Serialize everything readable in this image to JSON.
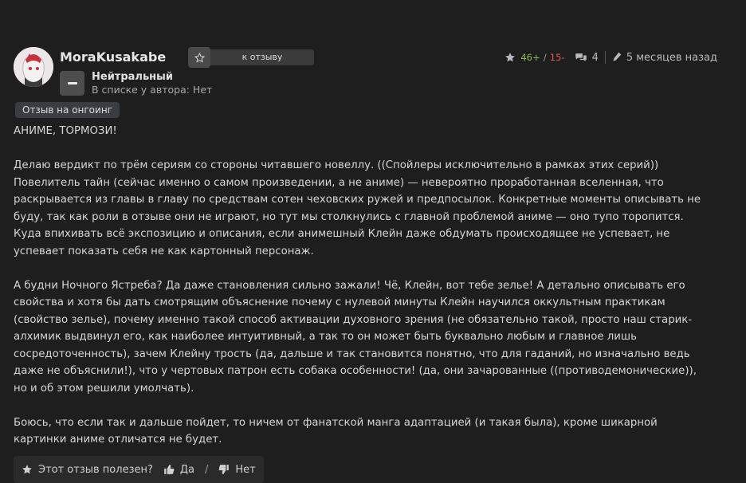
{
  "author": {
    "username": "MoraKusakabe"
  },
  "actions": {
    "to_review_label": "к отзыву"
  },
  "verdict": {
    "label": "Нейтральный",
    "in_list_prefix": "В списке у автора:",
    "in_list_value": "Нет"
  },
  "meta": {
    "votes_plus": "46+",
    "votes_slash": "/",
    "votes_minus": "15-",
    "comments_count": "4",
    "time_ago": "5 месяцев назад"
  },
  "badge": {
    "label": "Отзыв на онгоинг"
  },
  "review": {
    "paragraphs": [
      "АНИМЕ, ТОРМОЗИ!",
      "Делаю вердикт по трём сериям со стороны читавшего новеллу. ((Спойлеры исключительно в рамках этих серий))\nПовелитель тайн (сейчас именно о самом произведении, а не аниме) — невероятно проработанная вселенная, что\nраскрывается из главы в главу по средствам сотен чеховских ружей и предпосылок. Конкретные моменты описывать не\nбуду, так как роли в отзыве они не играют, но тут мы столкнулись с главной проблемой аниме — оно тупо торопится.\nКуда впихивать всё экспозицию и описания, если анимешный Клейн даже обдумать происходящее не успевает, не\nуспевает показать себя не как картонный персонаж.",
      "А будни Ночного Ястреба? Да даже становления сильно зажали! Чё, Клейн, вот тебе зелье! А детально описывать его\nсвойства и хотя бы дать смотрящим объяснение почему с нулевой минуты Клейн научился оккультным практикам\n(свойство зелье), почему именно такой способ активации духовного зрения (не обязательно такой, просто наш старик-\nалхимик выдвинул его, как наиболее интуитивный, а так то он может быть буквально любым и главное лишь\nсосредоточенность), зачем Клейну трость (да, дальше и так становится понятно, что для гаданий, но изначально ведь\nдаже не объяснили!), что у чертовых патрон есть собака особенности! (да, они зачарованные ((противодемонические)),\nно и об этом решили умолчать).",
      "Боюсь, что если так и дальше пойдет, то ничем от фанатской манга адаптацией (и такая была), кроме шикарной\nкартинки аниме отличатся не будет."
    ]
  },
  "helpful": {
    "question": "Этот отзыв полезен?",
    "yes_label": "Да",
    "separator": "/",
    "no_label": "Нет"
  },
  "icons": {
    "star": "star-icon",
    "comments": "comments-icon",
    "edit": "pen-icon",
    "thumbs_up": "thumbs-up-icon",
    "thumbs_down": "thumbs-down-icon"
  }
}
